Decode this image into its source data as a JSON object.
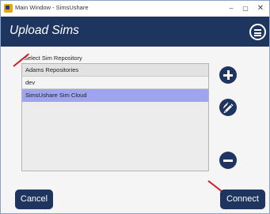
{
  "window": {
    "title": "Main Window - SimsUshare",
    "controls": {
      "minimize": "–",
      "maximize": "▢",
      "close": "✕"
    }
  },
  "header": {
    "title": "Upload Sims",
    "menu_icon": "hamburger-menu-icon"
  },
  "repository": {
    "label": "Select Sim Repository",
    "items": [
      {
        "label": "Adams Repositories",
        "selected": false
      },
      {
        "label": "dev",
        "selected": false
      },
      {
        "label": "SimsUshare Sim Cloud",
        "selected": true
      }
    ]
  },
  "actions": {
    "add_icon": "plus-icon",
    "edit_icon": "pen-icon",
    "remove_icon": "minus-icon"
  },
  "footer": {
    "cancel_label": "Cancel",
    "connect_label": "Connect"
  },
  "colors": {
    "header": "#1e3560",
    "selection": "#9ea5ee",
    "annotation": "#cc1f1f"
  }
}
